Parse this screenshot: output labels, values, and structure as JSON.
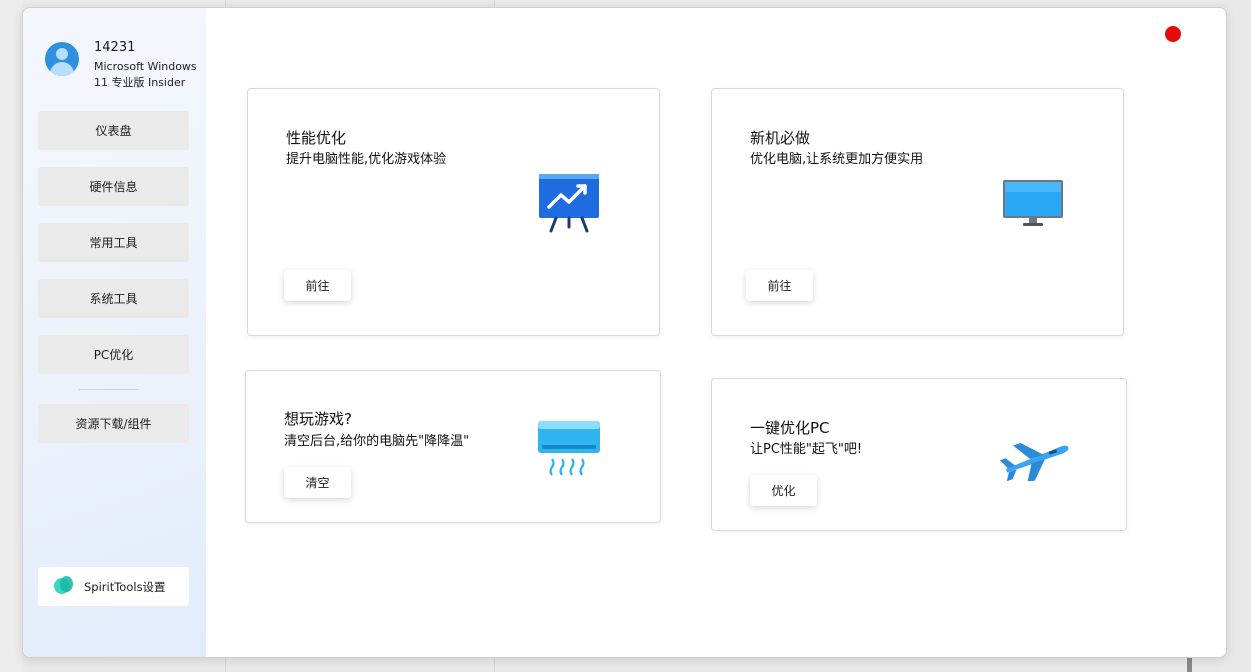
{
  "user": {
    "name": "14231",
    "os": "Microsoft Windows 11 专业版 Insider"
  },
  "sidebar": {
    "items": [
      {
        "label": "仪表盘"
      },
      {
        "label": "硬件信息"
      },
      {
        "label": "常用工具"
      },
      {
        "label": "系统工具"
      },
      {
        "label": "PC优化"
      },
      {
        "label": "资源下载/组件"
      }
    ],
    "settings_label": "SpiritTools设置"
  },
  "cards": [
    {
      "title": "性能优化",
      "subtitle": "提升电脑性能,优化游戏体验",
      "button": "前往",
      "icon": "presentation-chart-icon"
    },
    {
      "title": "新机必做",
      "subtitle": "优化电脑,让系统更加方便实用",
      "button": "前往",
      "icon": "monitor-icon"
    },
    {
      "title": "想玩游戏?",
      "subtitle": "清空后台,给你的电脑先\"降降温\"",
      "button": "清空",
      "icon": "air-conditioner-icon"
    },
    {
      "title": "一键优化PC",
      "subtitle": "让PC性能\"起飞\"吧!",
      "button": "优化",
      "icon": "airplane-icon"
    }
  ],
  "colors": {
    "close": "#e50b0b",
    "avatar": "#2f8fe0",
    "sidebar_gradient_end": "#e2ecfb"
  }
}
